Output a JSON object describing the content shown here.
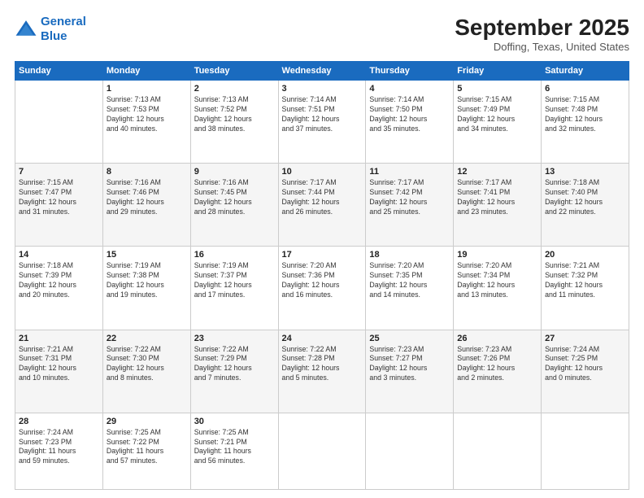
{
  "header": {
    "logo_line1": "General",
    "logo_line2": "Blue",
    "title": "September 2025",
    "subtitle": "Doffing, Texas, United States"
  },
  "days_of_week": [
    "Sunday",
    "Monday",
    "Tuesday",
    "Wednesday",
    "Thursday",
    "Friday",
    "Saturday"
  ],
  "weeks": [
    [
      {
        "num": "",
        "info": ""
      },
      {
        "num": "1",
        "info": "Sunrise: 7:13 AM\nSunset: 7:53 PM\nDaylight: 12 hours\nand 40 minutes."
      },
      {
        "num": "2",
        "info": "Sunrise: 7:13 AM\nSunset: 7:52 PM\nDaylight: 12 hours\nand 38 minutes."
      },
      {
        "num": "3",
        "info": "Sunrise: 7:14 AM\nSunset: 7:51 PM\nDaylight: 12 hours\nand 37 minutes."
      },
      {
        "num": "4",
        "info": "Sunrise: 7:14 AM\nSunset: 7:50 PM\nDaylight: 12 hours\nand 35 minutes."
      },
      {
        "num": "5",
        "info": "Sunrise: 7:15 AM\nSunset: 7:49 PM\nDaylight: 12 hours\nand 34 minutes."
      },
      {
        "num": "6",
        "info": "Sunrise: 7:15 AM\nSunset: 7:48 PM\nDaylight: 12 hours\nand 32 minutes."
      }
    ],
    [
      {
        "num": "7",
        "info": "Sunrise: 7:15 AM\nSunset: 7:47 PM\nDaylight: 12 hours\nand 31 minutes."
      },
      {
        "num": "8",
        "info": "Sunrise: 7:16 AM\nSunset: 7:46 PM\nDaylight: 12 hours\nand 29 minutes."
      },
      {
        "num": "9",
        "info": "Sunrise: 7:16 AM\nSunset: 7:45 PM\nDaylight: 12 hours\nand 28 minutes."
      },
      {
        "num": "10",
        "info": "Sunrise: 7:17 AM\nSunset: 7:44 PM\nDaylight: 12 hours\nand 26 minutes."
      },
      {
        "num": "11",
        "info": "Sunrise: 7:17 AM\nSunset: 7:42 PM\nDaylight: 12 hours\nand 25 minutes."
      },
      {
        "num": "12",
        "info": "Sunrise: 7:17 AM\nSunset: 7:41 PM\nDaylight: 12 hours\nand 23 minutes."
      },
      {
        "num": "13",
        "info": "Sunrise: 7:18 AM\nSunset: 7:40 PM\nDaylight: 12 hours\nand 22 minutes."
      }
    ],
    [
      {
        "num": "14",
        "info": "Sunrise: 7:18 AM\nSunset: 7:39 PM\nDaylight: 12 hours\nand 20 minutes."
      },
      {
        "num": "15",
        "info": "Sunrise: 7:19 AM\nSunset: 7:38 PM\nDaylight: 12 hours\nand 19 minutes."
      },
      {
        "num": "16",
        "info": "Sunrise: 7:19 AM\nSunset: 7:37 PM\nDaylight: 12 hours\nand 17 minutes."
      },
      {
        "num": "17",
        "info": "Sunrise: 7:20 AM\nSunset: 7:36 PM\nDaylight: 12 hours\nand 16 minutes."
      },
      {
        "num": "18",
        "info": "Sunrise: 7:20 AM\nSunset: 7:35 PM\nDaylight: 12 hours\nand 14 minutes."
      },
      {
        "num": "19",
        "info": "Sunrise: 7:20 AM\nSunset: 7:34 PM\nDaylight: 12 hours\nand 13 minutes."
      },
      {
        "num": "20",
        "info": "Sunrise: 7:21 AM\nSunset: 7:32 PM\nDaylight: 12 hours\nand 11 minutes."
      }
    ],
    [
      {
        "num": "21",
        "info": "Sunrise: 7:21 AM\nSunset: 7:31 PM\nDaylight: 12 hours\nand 10 minutes."
      },
      {
        "num": "22",
        "info": "Sunrise: 7:22 AM\nSunset: 7:30 PM\nDaylight: 12 hours\nand 8 minutes."
      },
      {
        "num": "23",
        "info": "Sunrise: 7:22 AM\nSunset: 7:29 PM\nDaylight: 12 hours\nand 7 minutes."
      },
      {
        "num": "24",
        "info": "Sunrise: 7:22 AM\nSunset: 7:28 PM\nDaylight: 12 hours\nand 5 minutes."
      },
      {
        "num": "25",
        "info": "Sunrise: 7:23 AM\nSunset: 7:27 PM\nDaylight: 12 hours\nand 3 minutes."
      },
      {
        "num": "26",
        "info": "Sunrise: 7:23 AM\nSunset: 7:26 PM\nDaylight: 12 hours\nand 2 minutes."
      },
      {
        "num": "27",
        "info": "Sunrise: 7:24 AM\nSunset: 7:25 PM\nDaylight: 12 hours\nand 0 minutes."
      }
    ],
    [
      {
        "num": "28",
        "info": "Sunrise: 7:24 AM\nSunset: 7:23 PM\nDaylight: 11 hours\nand 59 minutes."
      },
      {
        "num": "29",
        "info": "Sunrise: 7:25 AM\nSunset: 7:22 PM\nDaylight: 11 hours\nand 57 minutes."
      },
      {
        "num": "30",
        "info": "Sunrise: 7:25 AM\nSunset: 7:21 PM\nDaylight: 11 hours\nand 56 minutes."
      },
      {
        "num": "",
        "info": ""
      },
      {
        "num": "",
        "info": ""
      },
      {
        "num": "",
        "info": ""
      },
      {
        "num": "",
        "info": ""
      }
    ]
  ]
}
